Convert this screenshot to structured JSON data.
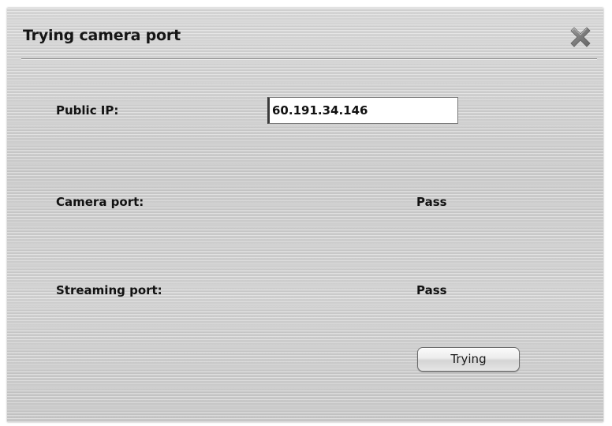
{
  "dialog": {
    "title": "Trying camera port",
    "close_icon": "close-x-icon"
  },
  "form": {
    "public_ip_label": "Public IP:",
    "public_ip_value": "60.191.34.146",
    "camera_port_label": "Camera port:",
    "camera_port_status": "Pass",
    "streaming_port_label": "Streaming port:",
    "streaming_port_status": "Pass"
  },
  "actions": {
    "trying_label": "Trying"
  }
}
